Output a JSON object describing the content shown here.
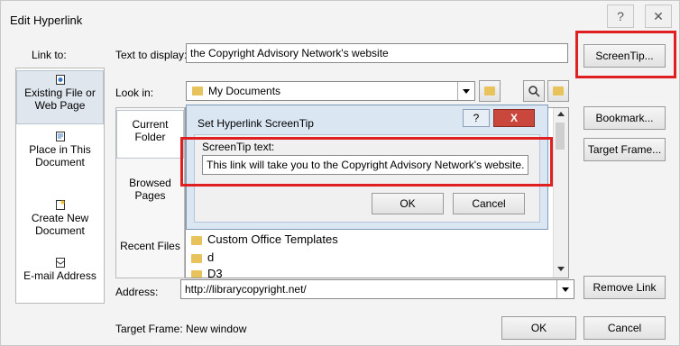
{
  "dialog": {
    "title": "Edit Hyperlink",
    "help_glyph": "?",
    "close_glyph": "✕"
  },
  "link_to": {
    "label": "Link to:",
    "items": [
      {
        "label": "Existing File or Web Page",
        "icon": "existing-file-icon"
      },
      {
        "label": "Place in This Document",
        "icon": "place-in-document-icon"
      },
      {
        "label": "Create New Document",
        "icon": "new-document-icon"
      },
      {
        "label": "E-mail Address",
        "icon": "email-icon"
      }
    ]
  },
  "text_to_display": {
    "label": "Text to display:",
    "value": "the Copyright Advisory Network's website"
  },
  "screentip_button": "ScreenTip...",
  "look_in": {
    "label": "Look in:",
    "value": "My Documents"
  },
  "side_nav": [
    "Current Folder",
    "Browsed Pages",
    "Recent Files"
  ],
  "file_list": [
    "Custom Office Templates",
    "d",
    "D3"
  ],
  "right_buttons": {
    "bookmark": "Bookmark...",
    "target_frame": "Target Frame...",
    "remove_link": "Remove Link",
    "ok": "OK",
    "cancel": "Cancel"
  },
  "address": {
    "label": "Address:",
    "value": "http://librarycopyright.net/"
  },
  "target_frame": {
    "label": "Target Frame:",
    "value": "New window"
  },
  "screentip_dialog": {
    "title": "Set Hyperlink ScreenTip",
    "help_glyph": "?",
    "close_glyph": "X",
    "field_label": "ScreenTip text:",
    "field_value": "This link will take you to the Copyright Advisory Network's website.",
    "ok": "OK",
    "cancel": "Cancel"
  },
  "colors": {
    "highlight": "#e02020",
    "close_button": "#c9473c"
  }
}
